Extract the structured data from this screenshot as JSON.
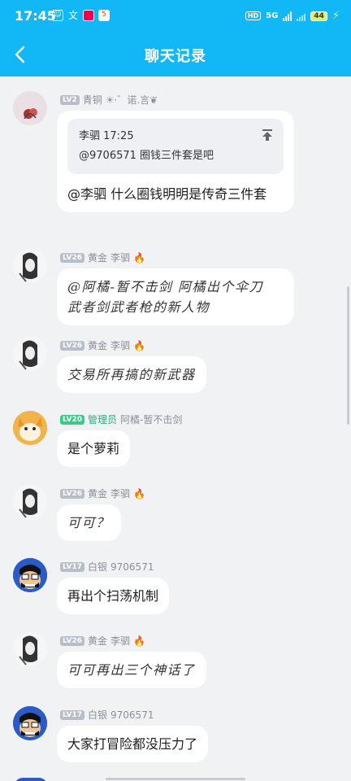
{
  "status": {
    "time": "17:45",
    "signal": "5G",
    "battery": "44"
  },
  "header": {
    "title": "聊天记录"
  },
  "messages": [
    {
      "level": "LV2",
      "rank": "青铜",
      "name": "☀·゛诺.言❦",
      "quote": {
        "sender_time": "李驷 17:25",
        "text": "@9706571 圈钱三件套是吧"
      },
      "text": "@李驷 什么圈钱明明是传奇三件套"
    },
    {
      "level": "LV26",
      "rank": "黄金",
      "name": "李驷",
      "text_line1": "@阿橘-暂不击剑 阿橘出个伞刀",
      "text_line2": "武者剑武者枪的新人物"
    },
    {
      "level": "LV26",
      "rank": "黄金",
      "name": "李驷",
      "text": "交易所再搞的新武器"
    },
    {
      "level": "LV20",
      "rank": "管理员",
      "name": "阿橘-暂不击剑",
      "text": "是个萝莉"
    },
    {
      "level": "LV26",
      "rank": "黄金",
      "name": "李驷",
      "text": "可可？"
    },
    {
      "level": "LV17",
      "rank": "白银",
      "name": "9706571",
      "text": "再出个扫荡机制"
    },
    {
      "level": "LV26",
      "rank": "黄金",
      "name": "李驷",
      "text": "可可再出三个神话了"
    },
    {
      "level": "LV17",
      "rank": "白银",
      "name": "9706571",
      "text": "大家打冒险都没压力了"
    }
  ]
}
